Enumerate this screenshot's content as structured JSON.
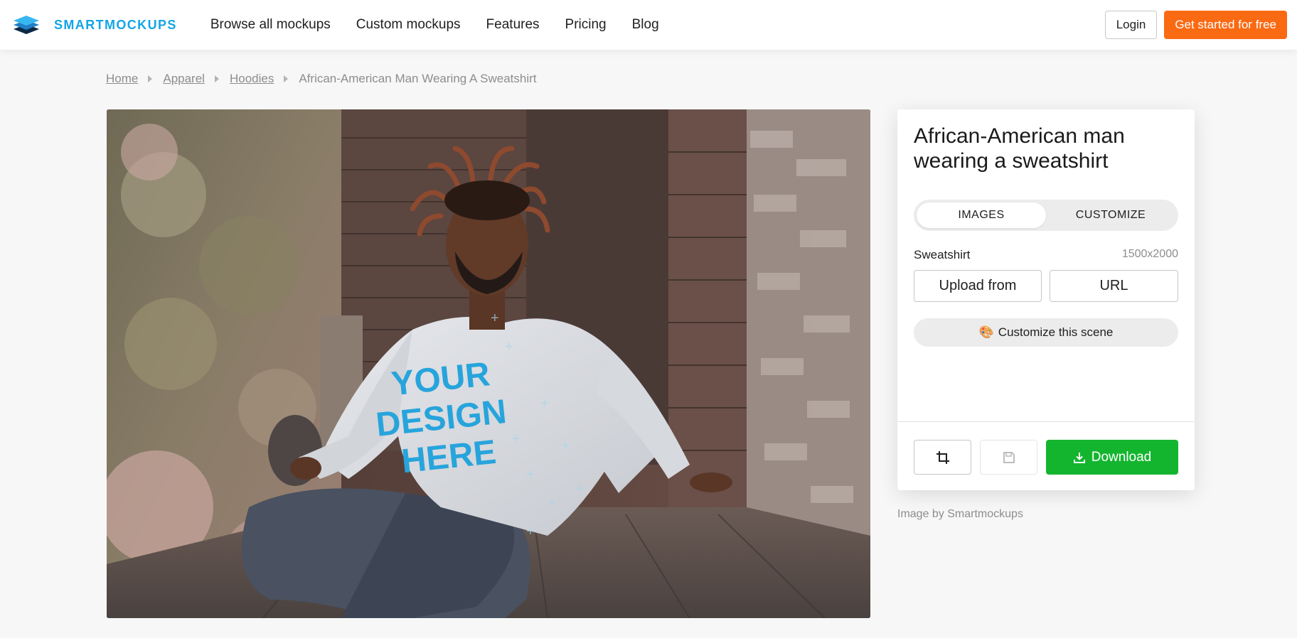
{
  "header": {
    "brand_name": "SMARTMOCKUPS",
    "nav": [
      "Browse all mockups",
      "Custom mockups",
      "Features",
      "Pricing",
      "Blog"
    ],
    "login_label": "Login",
    "cta_label": "Get started for free",
    "accent_color": "#12a5e6",
    "cta_color": "#fa6a13"
  },
  "breadcrumb": {
    "items": [
      "Home",
      "Apparel",
      "Hoodies"
    ],
    "current": "African-American Man Wearing A Sweatshirt"
  },
  "preview": {
    "design_lines": [
      "YOUR",
      "DESIGN",
      "HERE"
    ]
  },
  "panel": {
    "title": "African-American man wearing a sweatshirt",
    "tabs": [
      "IMAGES",
      "CUSTOMIZE"
    ],
    "active_tab": "IMAGES",
    "slot_label": "Sweatshirt",
    "slot_dimensions": "1500x2000",
    "upload_from_label": "Upload from",
    "url_label": "URL",
    "customize_scene_label": "Customize this scene",
    "customize_scene_icon": "palette-icon",
    "download_label": "Download",
    "download_color": "#13b52f",
    "crop_icon": "crop-icon",
    "save_icon": "save-icon"
  },
  "credit": "Image by Smartmockups"
}
